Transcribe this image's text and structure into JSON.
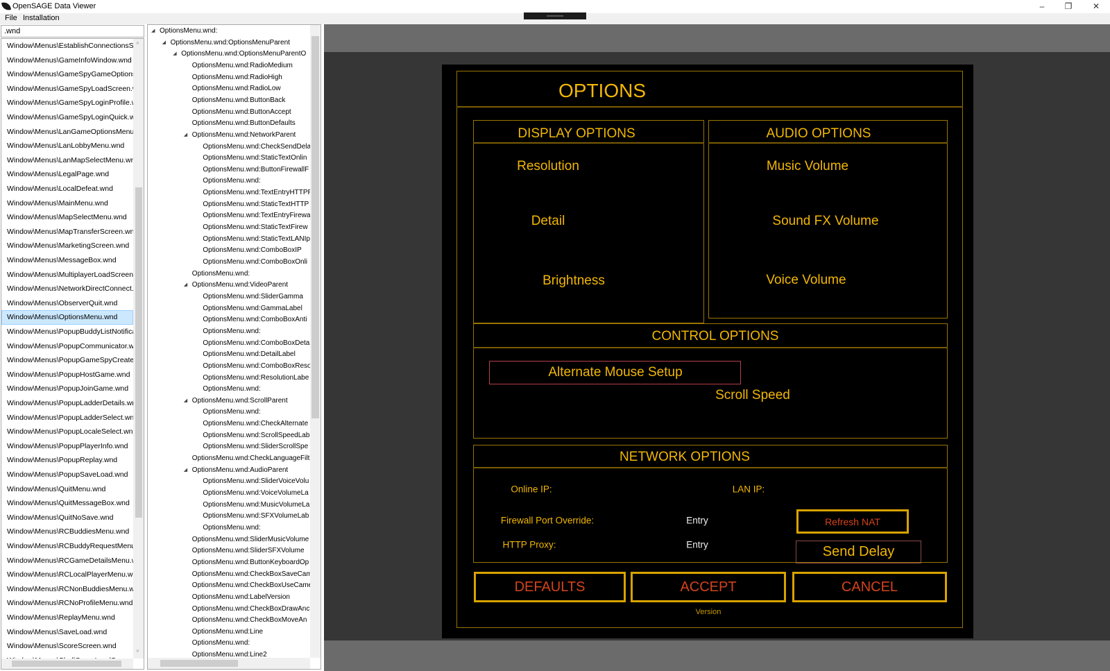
{
  "window": {
    "title": "OpenSAGE Data Viewer",
    "minimize": "–",
    "maximize": "❐",
    "close": "✕"
  },
  "menu": [
    "File",
    "Installation"
  ],
  "search": {
    "value": ".wnd"
  },
  "file_list": {
    "selected_index": 19,
    "items": [
      "Window\\Menus\\EstablishConnectionsScreen.wnd",
      "Window\\Menus\\GameInfoWindow.wnd",
      "Window\\Menus\\GameSpyGameOptionsMenu.wnd",
      "Window\\Menus\\GameSpyLoadScreen.wnd",
      "Window\\Menus\\GameSpyLoginProfile.wnd",
      "Window\\Menus\\GameSpyLoginQuick.wnd",
      "Window\\Menus\\LanGameOptionsMenu.wnd",
      "Window\\Menus\\LanLobbyMenu.wnd",
      "Window\\Menus\\LanMapSelectMenu.wnd",
      "Window\\Menus\\LegalPage.wnd",
      "Window\\Menus\\LocalDefeat.wnd",
      "Window\\Menus\\MainMenu.wnd",
      "Window\\Menus\\MapSelectMenu.wnd",
      "Window\\Menus\\MapTransferScreen.wnd",
      "Window\\Menus\\MarketingScreen.wnd",
      "Window\\Menus\\MessageBox.wnd",
      "Window\\Menus\\MultiplayerLoadScreen.wnd",
      "Window\\Menus\\NetworkDirectConnect.wnd",
      "Window\\Menus\\ObserverQuit.wnd",
      "Window\\Menus\\OptionsMenu.wnd",
      "Window\\Menus\\PopupBuddyListNotification.wnd",
      "Window\\Menus\\PopupCommunicator.wnd",
      "Window\\Menus\\PopupGameSpyCreateGame.wnd",
      "Window\\Menus\\PopupHostGame.wnd",
      "Window\\Menus\\PopupJoinGame.wnd",
      "Window\\Menus\\PopupLadderDetails.wnd",
      "Window\\Menus\\PopupLadderSelect.wnd",
      "Window\\Menus\\PopupLocaleSelect.wnd",
      "Window\\Menus\\PopupPlayerInfo.wnd",
      "Window\\Menus\\PopupReplay.wnd",
      "Window\\Menus\\PopupSaveLoad.wnd",
      "Window\\Menus\\QuitMenu.wnd",
      "Window\\Menus\\QuitMessageBox.wnd",
      "Window\\Menus\\QuitNoSave.wnd",
      "Window\\Menus\\RCBuddiesMenu.wnd",
      "Window\\Menus\\RCBuddyRequestMenu.wnd",
      "Window\\Menus\\RCGameDetailsMenu.wnd",
      "Window\\Menus\\RCLocalPlayerMenu.wnd",
      "Window\\Menus\\RCNonBuddiesMenu.wnd",
      "Window\\Menus\\RCNoProfileMenu.wnd",
      "Window\\Menus\\ReplayMenu.wnd",
      "Window\\Menus\\SaveLoad.wnd",
      "Window\\Menus\\ScoreScreen.wnd",
      "Window\\Menus\\ShellGameLoadScreen.wnd"
    ]
  },
  "tree": [
    {
      "label": "OptionsMenu.wnd:",
      "level": 0,
      "expanded": true
    },
    {
      "label": "OptionsMenu.wnd:OptionsMenuParent",
      "level": 1,
      "expanded": true
    },
    {
      "label": "OptionsMenu.wnd:OptionsMenuParentO",
      "level": 2,
      "expanded": true
    },
    {
      "label": "OptionsMenu.wnd:RadioMedium",
      "level": 3
    },
    {
      "label": "OptionsMenu.wnd:RadioHigh",
      "level": 3
    },
    {
      "label": "OptionsMenu.wnd:RadioLow",
      "level": 3
    },
    {
      "label": "OptionsMenu.wnd:ButtonBack",
      "level": 3
    },
    {
      "label": "OptionsMenu.wnd:ButtonAccept",
      "level": 3
    },
    {
      "label": "OptionsMenu.wnd:ButtonDefaults",
      "level": 3
    },
    {
      "label": "OptionsMenu.wnd:NetworkParent",
      "level": 3,
      "expanded": true
    },
    {
      "label": "OptionsMenu.wnd:CheckSendDela",
      "level": 4
    },
    {
      "label": "OptionsMenu.wnd:StaticTextOnlin",
      "level": 4
    },
    {
      "label": "OptionsMenu.wnd:ButtonFirewallF",
      "level": 4
    },
    {
      "label": "OptionsMenu.wnd:",
      "level": 4
    },
    {
      "label": "OptionsMenu.wnd:TextEntryHTTPP",
      "level": 4
    },
    {
      "label": "OptionsMenu.wnd:StaticTextHTTP",
      "level": 4
    },
    {
      "label": "OptionsMenu.wnd:TextEntryFirewa",
      "level": 4
    },
    {
      "label": "OptionsMenu.wnd:StaticTextFirew",
      "level": 4
    },
    {
      "label": "OptionsMenu.wnd:StaticTextLANIp",
      "level": 4
    },
    {
      "label": "OptionsMenu.wnd:ComboBoxIP",
      "level": 4
    },
    {
      "label": "OptionsMenu.wnd:ComboBoxOnli",
      "level": 4
    },
    {
      "label": "OptionsMenu.wnd:",
      "level": 3
    },
    {
      "label": "OptionsMenu.wnd:VideoParent",
      "level": 3,
      "expanded": true
    },
    {
      "label": "OptionsMenu.wnd:SliderGamma",
      "level": 4
    },
    {
      "label": "OptionsMenu.wnd:GammaLabel",
      "level": 4
    },
    {
      "label": "OptionsMenu.wnd:ComboBoxAnti",
      "level": 4
    },
    {
      "label": "OptionsMenu.wnd:",
      "level": 4
    },
    {
      "label": "OptionsMenu.wnd:ComboBoxDeta",
      "level": 4
    },
    {
      "label": "OptionsMenu.wnd:DetailLabel",
      "level": 4
    },
    {
      "label": "OptionsMenu.wnd:ComboBoxReso",
      "level": 4
    },
    {
      "label": "OptionsMenu.wnd:ResolutionLabe",
      "level": 4
    },
    {
      "label": "OptionsMenu.wnd:",
      "level": 4
    },
    {
      "label": "OptionsMenu.wnd:ScrollParent",
      "level": 3,
      "expanded": true
    },
    {
      "label": "OptionsMenu.wnd:",
      "level": 4
    },
    {
      "label": "OptionsMenu.wnd:CheckAlternate",
      "level": 4
    },
    {
      "label": "OptionsMenu.wnd:ScrollSpeedLab",
      "level": 4
    },
    {
      "label": "OptionsMenu.wnd:SliderScrollSpe",
      "level": 4
    },
    {
      "label": "OptionsMenu.wnd:CheckLanguageFilt",
      "level": 3
    },
    {
      "label": "OptionsMenu.wnd:AudioParent",
      "level": 3,
      "expanded": true
    },
    {
      "label": "OptionsMenu.wnd:SliderVoiceVolu",
      "level": 4
    },
    {
      "label": "OptionsMenu.wnd:VoiceVolumeLa",
      "level": 4
    },
    {
      "label": "OptionsMenu.wnd:MusicVolumeLa",
      "level": 4
    },
    {
      "label": "OptionsMenu.wnd:SFXVolumeLab",
      "level": 4
    },
    {
      "label": "OptionsMenu.wnd:",
      "level": 4
    },
    {
      "label": "OptionsMenu.wnd:SliderMusicVolume",
      "level": 3
    },
    {
      "label": "OptionsMenu.wnd:SliderSFXVolume",
      "level": 3
    },
    {
      "label": "OptionsMenu.wnd:ButtonKeyboardOp",
      "level": 3
    },
    {
      "label": "OptionsMenu.wnd:CheckBoxSaveCam",
      "level": 3
    },
    {
      "label": "OptionsMenu.wnd:CheckBoxUseCame",
      "level": 3
    },
    {
      "label": "OptionsMenu.wnd:LabelVersion",
      "level": 3
    },
    {
      "label": "OptionsMenu.wnd:CheckBoxDrawAnc",
      "level": 3
    },
    {
      "label": "OptionsMenu.wnd:CheckBoxMoveAn",
      "level": 3
    },
    {
      "label": "OptionsMenu.wnd:Line",
      "level": 3
    },
    {
      "label": "OptionsMenu.wnd:",
      "level": 3
    },
    {
      "label": "OptionsMenu.wnd:Line2",
      "level": 3
    }
  ],
  "game": {
    "title": "OPTIONS",
    "display": {
      "header": "DISPLAY OPTIONS",
      "resolution": "Resolution",
      "detail": "Detail",
      "brightness": "Brightness"
    },
    "audio": {
      "header": "AUDIO OPTIONS",
      "music": "Music Volume",
      "sfx": "Sound FX Volume",
      "voice": "Voice Volume"
    },
    "control": {
      "header": "CONTROL OPTIONS",
      "alt_mouse": "Alternate Mouse Setup",
      "scroll_speed": "Scroll Speed"
    },
    "network": {
      "header": "NETWORK OPTIONS",
      "online_ip": "Online IP:",
      "lan_ip": "LAN IP:",
      "firewall": "Firewall Port Override:",
      "firewall_entry": "Entry",
      "http_proxy": "HTTP Proxy:",
      "http_entry": "Entry",
      "refresh_nat": "Refresh NAT",
      "send_delay": "Send Delay"
    },
    "buttons": {
      "defaults": "DEFAULTS",
      "accept": "ACCEPT",
      "cancel": "CANCEL"
    },
    "version": "Version",
    "colors": {
      "text": "#f2b705",
      "border": "#9a7500",
      "button_text": "#d5431b"
    }
  }
}
